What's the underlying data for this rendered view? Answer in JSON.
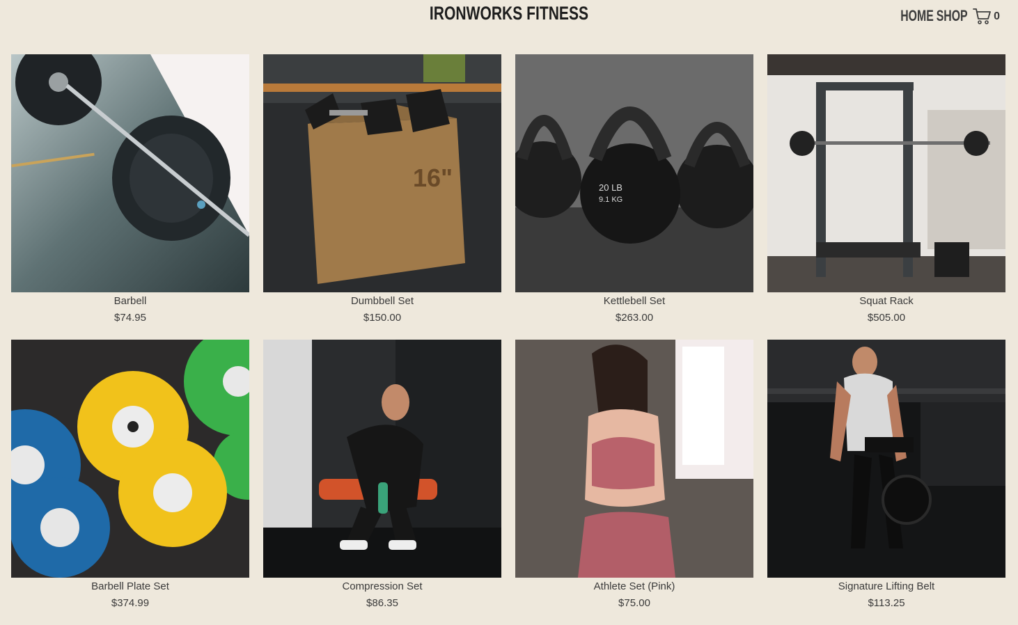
{
  "header": {
    "brand": "IRONWORKS FITNESS",
    "nav": {
      "home_label": "HOME",
      "shop_label": "SHOP",
      "cart_count": "0"
    }
  },
  "products": [
    {
      "name": "Barbell",
      "price": "$74.95",
      "image": "barbell-photo"
    },
    {
      "name": "Dumbbell Set",
      "price": "$150.00",
      "image": "dumbbells-on-plyo-box-photo"
    },
    {
      "name": "Kettlebell Set",
      "price": "$263.00",
      "image": "kettlebells-photo"
    },
    {
      "name": "Squat Rack",
      "price": "$505.00",
      "image": "squat-rack-photo"
    },
    {
      "name": "Barbell Plate Set",
      "price": "$374.99",
      "image": "bumper-plates-photo"
    },
    {
      "name": "Compression Set",
      "price": "$86.35",
      "image": "man-in-compression-wear-photo"
    },
    {
      "name": "Athlete Set (Pink)",
      "price": "$75.00",
      "image": "woman-in-pink-set-photo"
    },
    {
      "name": "Signature Lifting Belt",
      "price": "$113.25",
      "image": "man-with-lifting-belt-photo"
    }
  ],
  "colors": {
    "background": "#EEE8DC",
    "text": "#333333"
  }
}
